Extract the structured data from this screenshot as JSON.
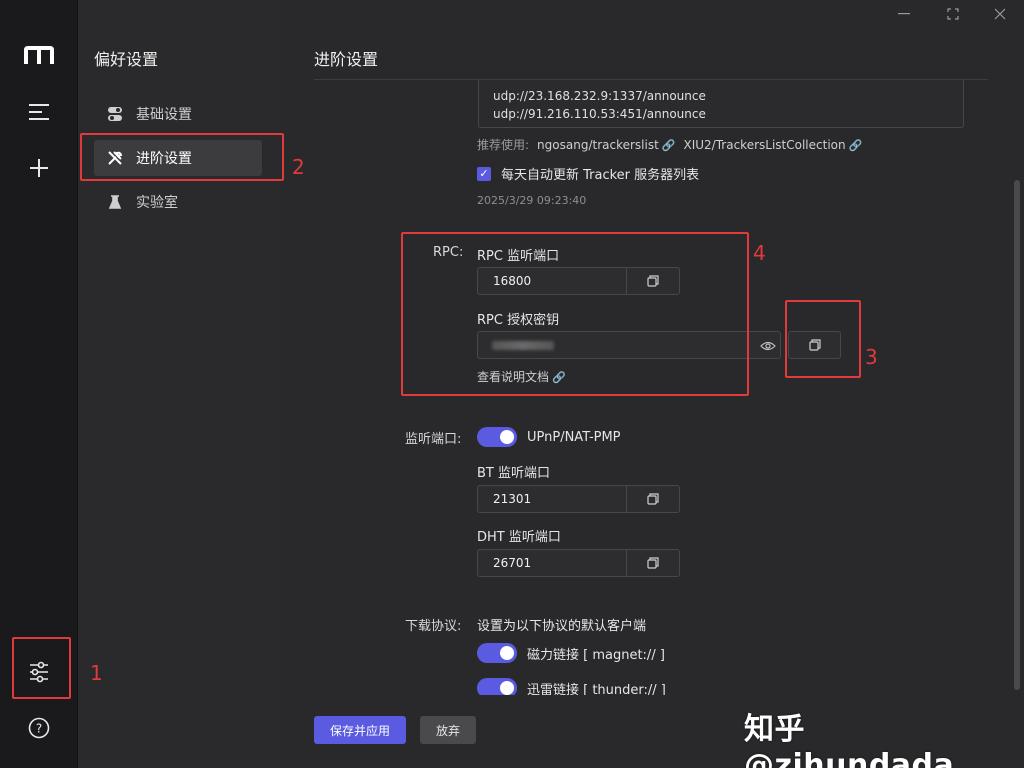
{
  "rail": {
    "logo": "m-logo-icon",
    "items": [
      "menu-icon",
      "plus-icon"
    ],
    "bottom": [
      "settings-sliders-icon",
      "help-icon"
    ]
  },
  "sidebar": {
    "title": "偏好设置",
    "items": [
      {
        "label": "基础设置",
        "icon": "toggle-icon"
      },
      {
        "label": "进阶设置",
        "icon": "wrench-icon"
      },
      {
        "label": "实验室",
        "icon": "flask-icon"
      }
    ]
  },
  "main": {
    "title": "进阶设置",
    "trackers": {
      "lines": [
        "udp://23.168.232.9:1337/announce",
        "udp://91.216.110.53:451/announce"
      ],
      "recommend_label": "推荐使用:",
      "recommend_links": [
        "ngosang/trackerslist",
        "XIU2/TrackersListCollection"
      ],
      "auto_update_label": "每天自动更新 Tracker 服务器列表",
      "auto_update_checked": true,
      "last_update": "2025/3/29 09:23:40"
    },
    "rpc": {
      "section_label": "RPC:",
      "port_label": "RPC 监听端口",
      "port_value": "16800",
      "secret_label": "RPC 授权密钥",
      "doc_link": "查看说明文档"
    },
    "listen": {
      "section_label": "监听端口:",
      "upnp_label": "UPnP/NAT-PMP",
      "upnp_on": true,
      "bt_label": "BT 监听端口",
      "bt_value": "21301",
      "dht_label": "DHT 监听端口",
      "dht_value": "26701"
    },
    "protocol": {
      "section_label": "下载协议:",
      "desc": "设置为以下协议的默认客户端",
      "magnet_label": "磁力链接 [ magnet:// ]",
      "magnet_on": true,
      "thunder_label": "迅雷链接 [ thunder:// ]",
      "thunder_on": true
    },
    "footer": {
      "save_label": "保存并应用",
      "discard_label": "放弃"
    }
  },
  "annotations": [
    "1",
    "2",
    "3",
    "4"
  ],
  "watermark": "知乎 @zihundada",
  "colors": {
    "accent": "#5a5be0",
    "annotation": "#e03a3a"
  }
}
